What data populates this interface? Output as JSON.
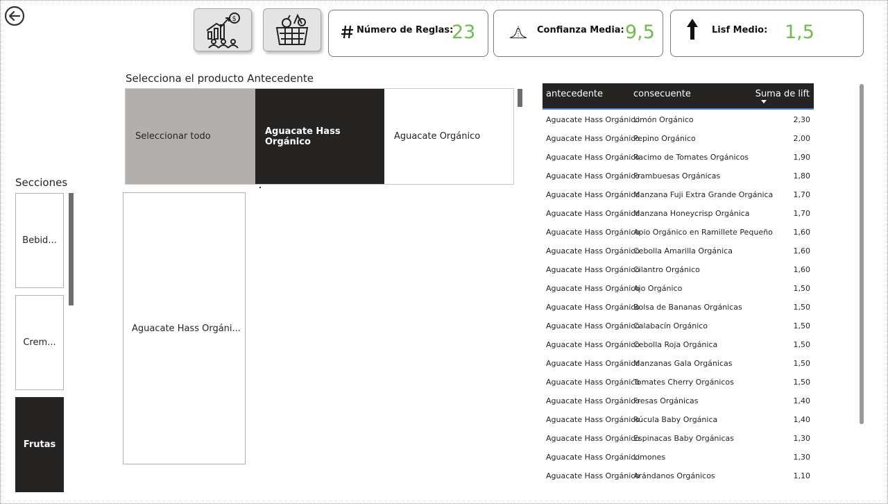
{
  "kpis": {
    "reglas": {
      "label": "Número de Reglas:",
      "value": "23",
      "icon": "hash-icon"
    },
    "confianza": {
      "label": "Confianza Media:",
      "value": "9,5",
      "icon": "bell-curve-icon"
    },
    "lisf": {
      "label": "Lisf Medio:",
      "value": "1,5",
      "icon": "up-arrow-icon"
    }
  },
  "nav": {
    "back_icon": "back-arrow-icon",
    "btn1_icon": "growth-team-icon",
    "btn2_icon": "grocery-basket-icon"
  },
  "antecedente": {
    "title": "Selecciona el producto Antecedente",
    "tiles": [
      "Seleccionar todo",
      "Aguacate Hass Orgánico",
      "Aguacate Orgánico"
    ],
    "selected": "Aguacate Hass Orgánico"
  },
  "card": {
    "label": "Aguacate Hass Orgáni..."
  },
  "secciones": {
    "title": "Secciones",
    "items": [
      "Bebid...",
      "Crem...",
      "Frutas"
    ],
    "selected": "Frutas"
  },
  "table": {
    "headers": [
      "antecedente",
      "consecuente",
      "Suma de lift"
    ],
    "rows": [
      [
        "Aguacate Hass Orgánico",
        "Limón Orgánico",
        "2,30"
      ],
      [
        "Aguacate Hass Orgánico",
        "Pepino Orgánico",
        "2,00"
      ],
      [
        "Aguacate Hass Orgánico",
        "Racimo de Tomates Orgánicos",
        "1,90"
      ],
      [
        "Aguacate Hass Orgánico",
        "Frambuesas Orgánicas",
        "1,80"
      ],
      [
        "Aguacate Hass Orgánico",
        "Manzana Fuji Extra Grande Orgánica",
        "1,70"
      ],
      [
        "Aguacate Hass Orgánico",
        "Manzana Honeycrisp Orgánica",
        "1,70"
      ],
      [
        "Aguacate Hass Orgánico",
        "Apio Orgánico en Ramillete Pequeño",
        "1,60"
      ],
      [
        "Aguacate Hass Orgánico",
        "Cebolla Amarilla Orgánica",
        "1,60"
      ],
      [
        "Aguacate Hass Orgánico",
        "Cilantro Orgánico",
        "1,60"
      ],
      [
        "Aguacate Hass Orgánico",
        "Ajo Orgánico",
        "1,50"
      ],
      [
        "Aguacate Hass Orgánico",
        "Bolsa de Bananas Orgánicas",
        "1,50"
      ],
      [
        "Aguacate Hass Orgánico",
        "Calabacín Orgánico",
        "1,50"
      ],
      [
        "Aguacate Hass Orgánico",
        "Cebolla Roja Orgánica",
        "1,50"
      ],
      [
        "Aguacate Hass Orgánico",
        "Manzanas Gala Orgánicas",
        "1,50"
      ],
      [
        "Aguacate Hass Orgánico",
        "Tomates Cherry Orgánicos",
        "1,50"
      ],
      [
        "Aguacate Hass Orgánico",
        "Fresas Orgánicas",
        "1,40"
      ],
      [
        "Aguacate Hass Orgánico",
        "Rúcula Baby Orgánica",
        "1,40"
      ],
      [
        "Aguacate Hass Orgánico",
        "Espinacas Baby Orgánicas",
        "1,30"
      ],
      [
        "Aguacate Hass Orgánico",
        "Limones",
        "1,30"
      ],
      [
        "Aguacate Hass Orgánico",
        "Arándanos Orgánicos",
        "1,10"
      ]
    ]
  }
}
